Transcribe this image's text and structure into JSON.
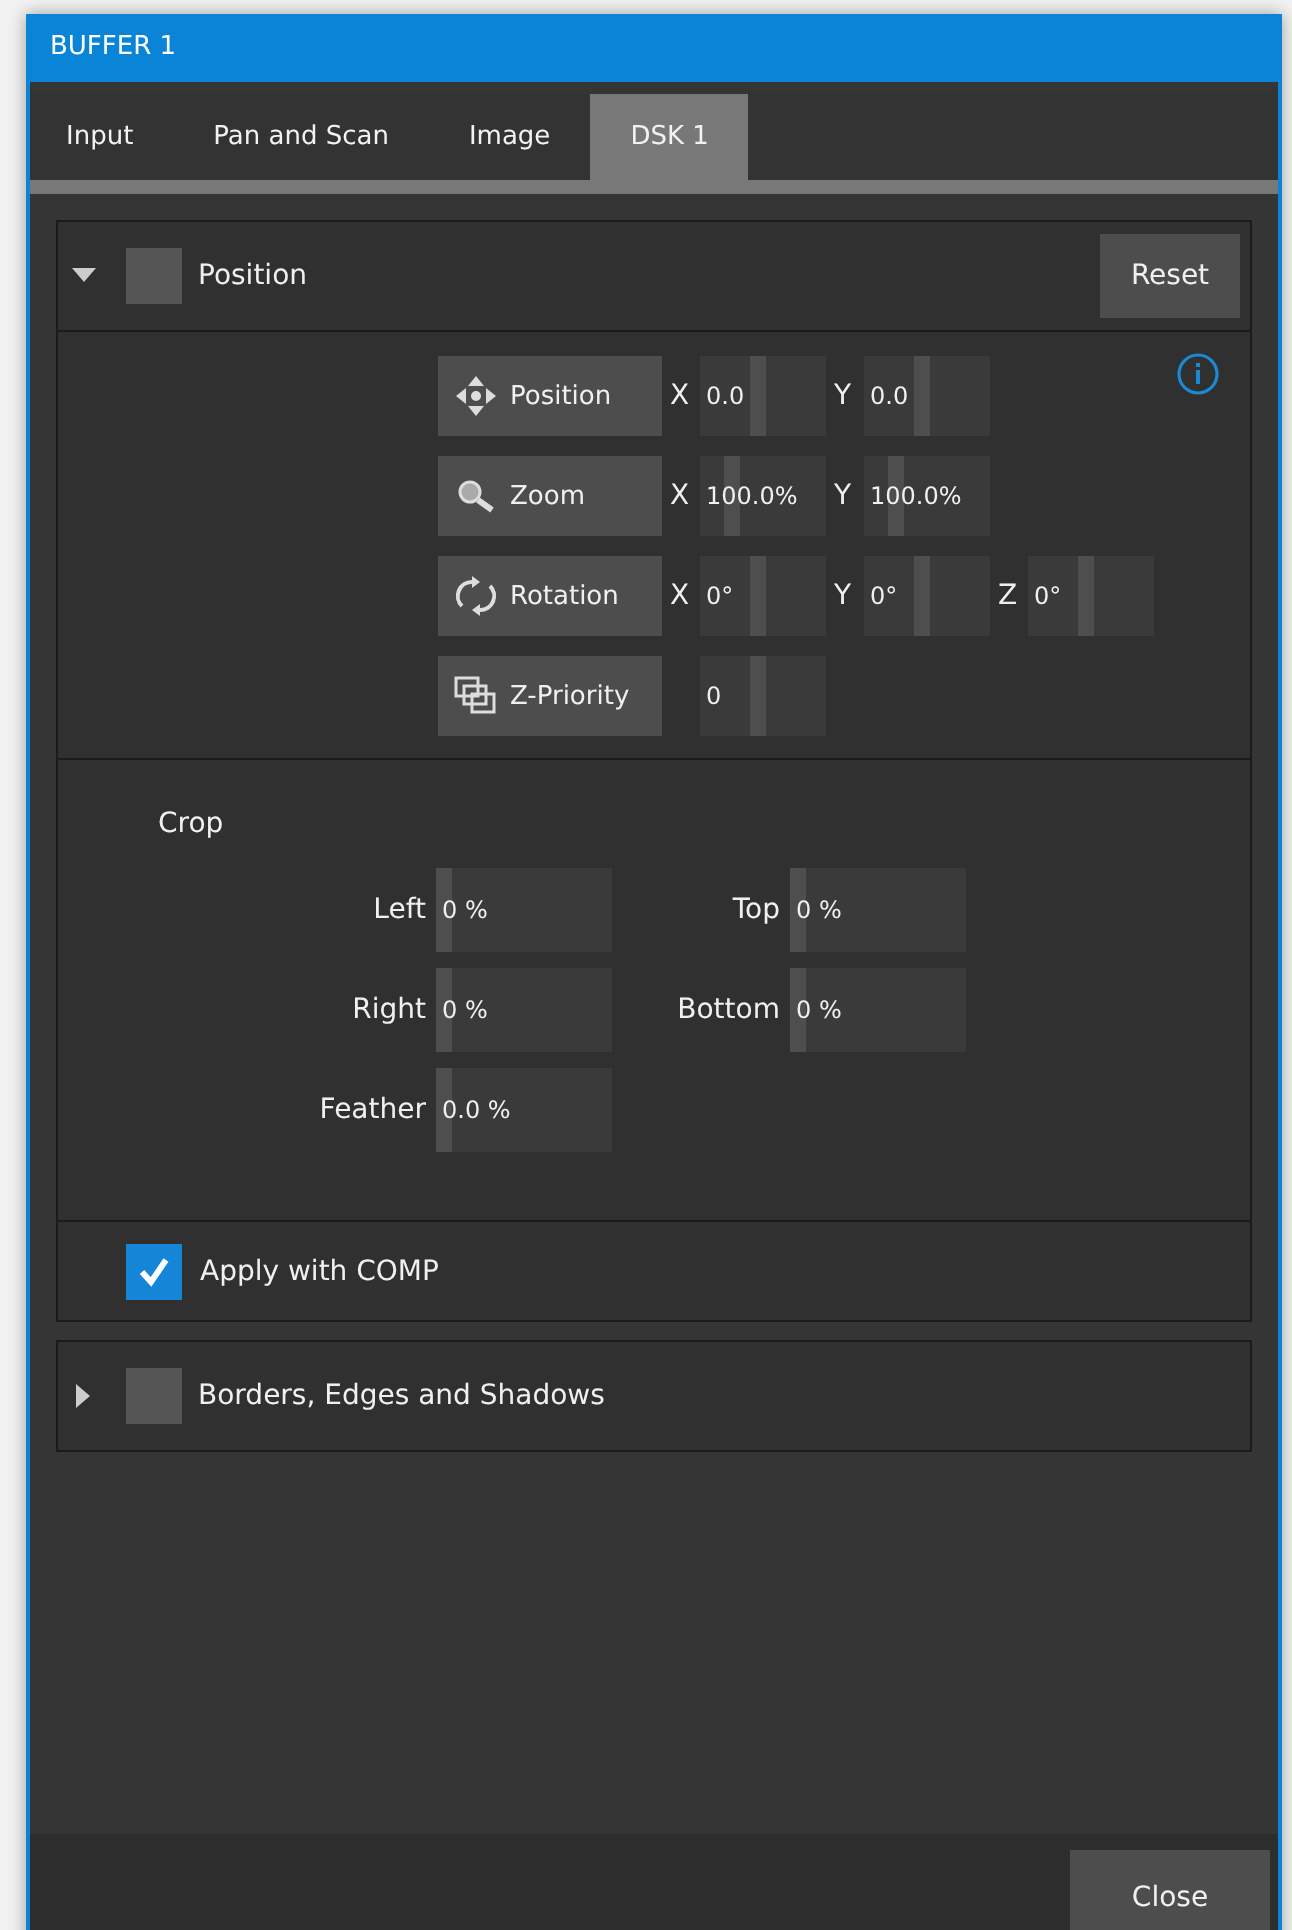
{
  "window": {
    "title": "BUFFER 1"
  },
  "tabs": [
    {
      "label": "Input",
      "selected": false
    },
    {
      "label": "Pan and Scan",
      "selected": false
    },
    {
      "label": "Image",
      "selected": false
    },
    {
      "label": "DSK 1",
      "selected": true
    }
  ],
  "sections": [
    {
      "title": "Position",
      "expanded": true,
      "checked": false,
      "reset": "Reset",
      "transform_rows": [
        {
          "label": "Position",
          "fields": [
            {
              "axis": "X",
              "value": "0.0",
              "level": 0.45
            },
            {
              "axis": "Y",
              "value": "0.0",
              "level": 0.45
            }
          ]
        },
        {
          "label": "Zoom",
          "fields": [
            {
              "axis": "X",
              "value": "100.0%",
              "level": 0.22
            },
            {
              "axis": "Y",
              "value": "100.0%",
              "level": 0.22
            }
          ]
        },
        {
          "label": "Rotation",
          "fields": [
            {
              "axis": "X",
              "value": "0°",
              "level": 0.45
            },
            {
              "axis": "Y",
              "value": "0°",
              "level": 0.45
            },
            {
              "axis": "Z",
              "value": "0°",
              "level": 0.45
            }
          ]
        },
        {
          "label": "Z-Priority",
          "fields": [
            {
              "value": "0",
              "level": 0.45
            }
          ]
        }
      ],
      "crop": {
        "title": "Crop",
        "fields": [
          {
            "label": "Left",
            "value": "0 %",
            "level": 0
          },
          {
            "label": "Top",
            "value": "0 %",
            "level": 0
          },
          {
            "label": "Right",
            "value": "0 %",
            "level": 0
          },
          {
            "label": "Bottom",
            "value": "0 %",
            "level": 0
          },
          {
            "label": "Feather",
            "value": "0.0 %",
            "level": 0
          }
        ]
      },
      "apply": {
        "label": "Apply with COMP",
        "checked": true
      }
    },
    {
      "title": "Borders, Edges and Shadows",
      "expanded": false,
      "checked": false
    }
  ],
  "footer": {
    "close": "Close"
  }
}
